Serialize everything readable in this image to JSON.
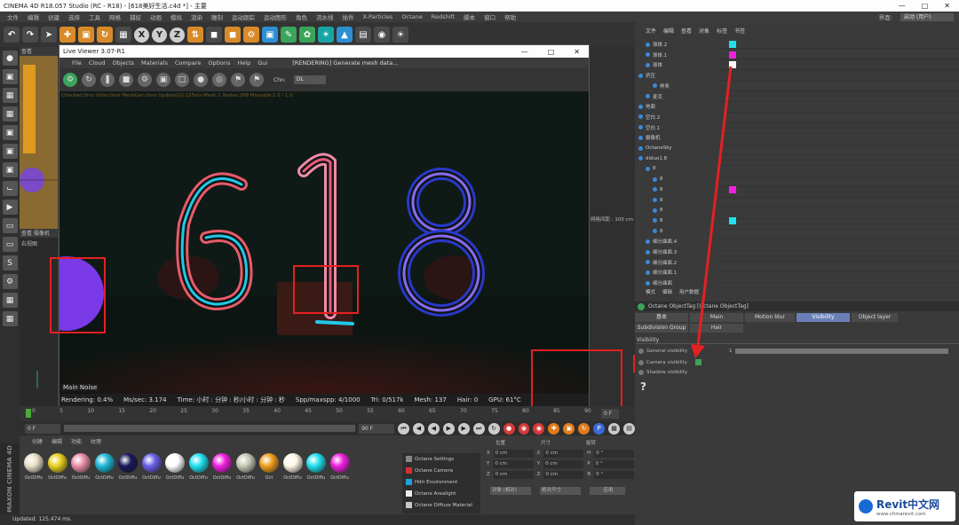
{
  "app": {
    "title": "CINEMA 4D R18.057 Studio (RC - R18) - [618美好生活.c4d *] - 主要",
    "menu": [
      "文件",
      "编辑",
      "创建",
      "选择",
      "工具",
      "网格",
      "捕捉",
      "动画",
      "模拟",
      "渲染",
      "雕刻",
      "运动跟踪",
      "运动图形",
      "角色",
      "流水线",
      "插件",
      "X-Particles",
      "Octane",
      "Redshift",
      "脚本",
      "窗口",
      "帮助"
    ],
    "layout_label": "界面:",
    "layout_value": "启动 (用户)",
    "toolbar_axes": [
      "X",
      "Y",
      "Z"
    ]
  },
  "viewports": {
    "top_label": "查看",
    "bottom_label": "查看  摄像机",
    "bottom_sub": "右视图",
    "right_grid": "网格间距 : 100 cm"
  },
  "live_viewer": {
    "title": "Live Viewer 3.07-R1",
    "menu": [
      "File",
      "Cloud",
      "Objects",
      "Materials",
      "Compare",
      "Options",
      "Help",
      "Gui"
    ],
    "status": "[RENDERING] Generate mesh data...",
    "chn_label": "Chn:",
    "chn_value": "DL",
    "debug_line": "Checked:0ms  Vidm:0ms  MeshGen:0ms  Update[G]:125ms  Mesh:1 Nodes:268 Movable:1  0 / 1:0",
    "render_text": "618",
    "tabs": "Main  Noise",
    "stats": {
      "rendering": "Rendering: 0.4%",
      "ms_sec": "Ms/sec: 3.174",
      "time": "Time: 小时 : 分钟 : 秒/小时 : 分钟 : 秒",
      "spp": "Spp/maxspp: 4/1000",
      "tri": "Tri: 0/517k",
      "mesh": "Mesh: 137",
      "hair": "Hair: 0",
      "gpu": "GPU: 61°C"
    }
  },
  "timeline": {
    "ticks": [
      "0",
      "5",
      "10",
      "15",
      "20",
      "25",
      "30",
      "35",
      "40",
      "45",
      "50",
      "55",
      "60",
      "65",
      "70",
      "75",
      "80",
      "85",
      "90"
    ],
    "start_field": "0 F",
    "end_field": "90 F",
    "frame_field": "0 F"
  },
  "materials": {
    "menu": [
      "创建",
      "编辑",
      "功能",
      "纹理"
    ],
    "items": [
      {
        "label": "OctDiffu",
        "color": "#e8e0c8"
      },
      {
        "label": "OctDiffu",
        "color": "#e8d020"
      },
      {
        "label": "OctDiffu",
        "color": "#e890a8"
      },
      {
        "label": "OctDiffu",
        "color": "#20b8d8"
      },
      {
        "label": "OctDiffu",
        "color": "#1a1a5a"
      },
      {
        "label": "OctDiffu",
        "color": "#6a60e8"
      },
      {
        "label": "OctDiffu",
        "color": "#ffffff"
      },
      {
        "label": "OctDiffu",
        "color": "#20e0f0"
      },
      {
        "label": "OctDiffu",
        "color": "#f020e0"
      },
      {
        "label": "OctDiffu",
        "color": "#c8c8b8"
      },
      {
        "label": "Oct",
        "color": "#f0a020"
      },
      {
        "label": "OctDiffu",
        "color": "#fff8e8"
      },
      {
        "label": "OctDiffu",
        "color": "#20e0f0"
      },
      {
        "label": "OctDiffu",
        "color": "#f020e0"
      }
    ],
    "octane_menu": [
      {
        "label": "Octane Settings",
        "color": "#888"
      },
      {
        "label": "Octane Camera",
        "color": "#d83030"
      },
      {
        "label": "Hdri Environment",
        "color": "#20a0e0"
      },
      {
        "label": "Octane Arealight",
        "color": "#eeeeee"
      },
      {
        "label": "Octane Diffuse Material",
        "color": "#c8c8c8"
      }
    ]
  },
  "coords": {
    "headers": [
      "位置",
      "尺寸",
      "旋转"
    ],
    "rows": [
      {
        "axis1": "X",
        "pos": "0 cm",
        "axis2": "X",
        "size": "0 cm",
        "axis3": "H",
        "rot": "0 °"
      },
      {
        "axis1": "Y",
        "pos": "0 cm",
        "axis2": "Y",
        "size": "0 cm",
        "axis3": "P",
        "rot": "0 °"
      },
      {
        "axis1": "Z",
        "pos": "0 cm",
        "axis2": "Z",
        "size": "0 cm",
        "axis3": "B",
        "rot": "0 °"
      }
    ],
    "mode": "对象 (相对)",
    "size_mode": "绝对尺寸",
    "apply": "应用"
  },
  "objects": {
    "menu": [
      "文件",
      "编辑",
      "查看",
      "对象",
      "标签",
      "书签"
    ],
    "rows": [
      {
        "name": "球体.2",
        "indent": 1,
        "tag": "#20e0f0"
      },
      {
        "name": "球体.1",
        "indent": 1,
        "tag": "#f020e0"
      },
      {
        "name": "球体",
        "indent": 1,
        "tag": "#ffffff"
      },
      {
        "name": "挤压",
        "indent": 0,
        "tag": ""
      },
      {
        "name": "样条",
        "indent": 2,
        "tag": ""
      },
      {
        "name": "麦克",
        "indent": 1,
        "tag": ""
      },
      {
        "name": "地面",
        "indent": 0,
        "tag": ""
      },
      {
        "name": "空白.2",
        "indent": 0,
        "tag": ""
      },
      {
        "name": "空白.1",
        "indent": 0,
        "tag": ""
      },
      {
        "name": "摄像机",
        "indent": 0,
        "tag": ""
      },
      {
        "name": "OctaneSky",
        "indent": 0,
        "tag": ""
      },
      {
        "name": "diduo1.8",
        "indent": 0,
        "tag": ""
      },
      {
        "name": "8",
        "indent": 1,
        "tag": ""
      },
      {
        "name": "8",
        "indent": 2,
        "tag": ""
      },
      {
        "name": "8",
        "indent": 2,
        "tag": "#f020e0"
      },
      {
        "name": "8",
        "indent": 2,
        "tag": ""
      },
      {
        "name": "8",
        "indent": 2,
        "tag": ""
      },
      {
        "name": "8",
        "indent": 2,
        "tag": "#20e0f0"
      },
      {
        "name": "8",
        "indent": 2,
        "tag": ""
      },
      {
        "name": "细分曲面.4",
        "indent": 1,
        "tag": ""
      },
      {
        "name": "细分曲面.3",
        "indent": 1,
        "tag": ""
      },
      {
        "name": "细分曲面.2",
        "indent": 1,
        "tag": ""
      },
      {
        "name": "细分曲面.1",
        "indent": 1,
        "tag": ""
      },
      {
        "name": "细分曲面",
        "indent": 1,
        "tag": ""
      }
    ]
  },
  "attributes": {
    "menu": [
      "模式",
      "编辑",
      "用户数据"
    ],
    "tag_title": "Octane ObjectTag [Octane ObjectTag]",
    "tabs": [
      "基本",
      "Main",
      "Motion blur",
      "Visibility",
      "Object layer",
      "Subdivision Group",
      "Hair"
    ],
    "active_tab": "Visibility",
    "section": "Visibility",
    "props": [
      "General visibility",
      "Camera visibility",
      "Shadow visibility"
    ],
    "general_value": "1",
    "help": "?"
  },
  "watermark": {
    "name": "Revit中文网",
    "url": "www.chinarevit.com"
  },
  "status_bar": "Updated: 125.474 ms.",
  "cinema_logo": "MAXON CINEMA 4D"
}
